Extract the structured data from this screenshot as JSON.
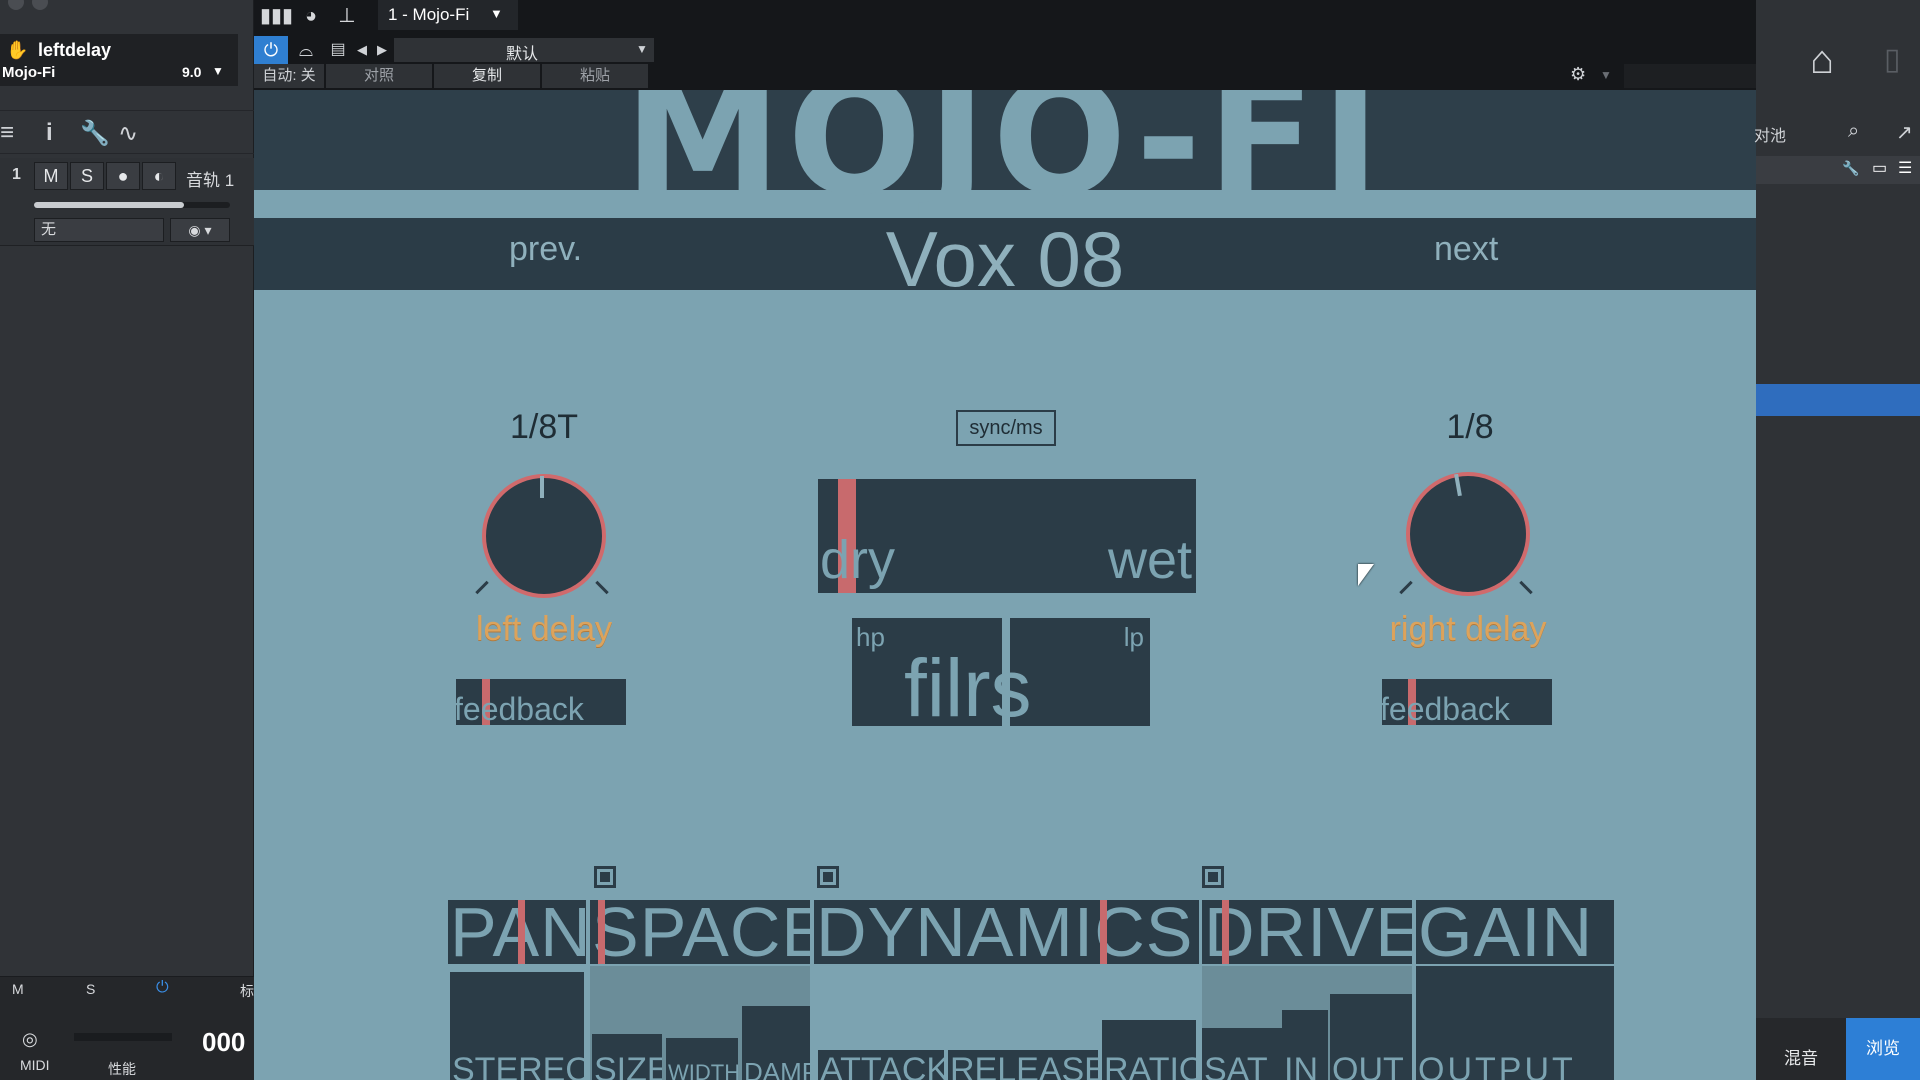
{
  "daw": {
    "device_name": "leftdelay",
    "plugin_name": "Mojo-Fi",
    "version": "9.0",
    "track_number": "1",
    "track_mute": "M",
    "track_solo": "S",
    "track_name": "音轨 1",
    "input_none": "无",
    "bottom_m": "M",
    "bottom_s": "S",
    "bottom_label": "标",
    "midi": "MIDI",
    "perf": "性能",
    "counter": "000"
  },
  "plugin_window": {
    "title": "1 - Mojo-Fi",
    "preset_menu": "默认",
    "auto_off": "自动: 关",
    "compare": "对照",
    "copy": "复制",
    "paste": "粘贴"
  },
  "mojo": {
    "title": "MOJO-FI",
    "prev": "prev.",
    "next": "next",
    "preset": "Vox 08",
    "left_value": "1/8T",
    "right_value": "1/8",
    "left_label": "left delay",
    "right_label": "right delay",
    "feedback": "feedback",
    "sync_ms": "sync/ms",
    "dry": "dry",
    "wet": "wet",
    "hp": "hp",
    "lp": "lp",
    "filters": "filrs",
    "sections": [
      "PAN",
      "SPACE",
      "DYNAMICS",
      "DRIVE",
      "GAIN"
    ],
    "bars": [
      "STEREO",
      "SIZE",
      "WIDTH",
      "DAMP",
      "ATTACK",
      "RELEASE",
      "RATIO",
      "SAT",
      "IN",
      "OUT",
      "OUTPUT"
    ],
    "colors": {
      "bg": "#7ca3b1",
      "dark": "#2b3c47",
      "accent": "#c86a6d",
      "label": "#dca35c"
    }
  },
  "browser": {
    "pool": "对池",
    "mix": "混音",
    "browse": "浏览"
  }
}
